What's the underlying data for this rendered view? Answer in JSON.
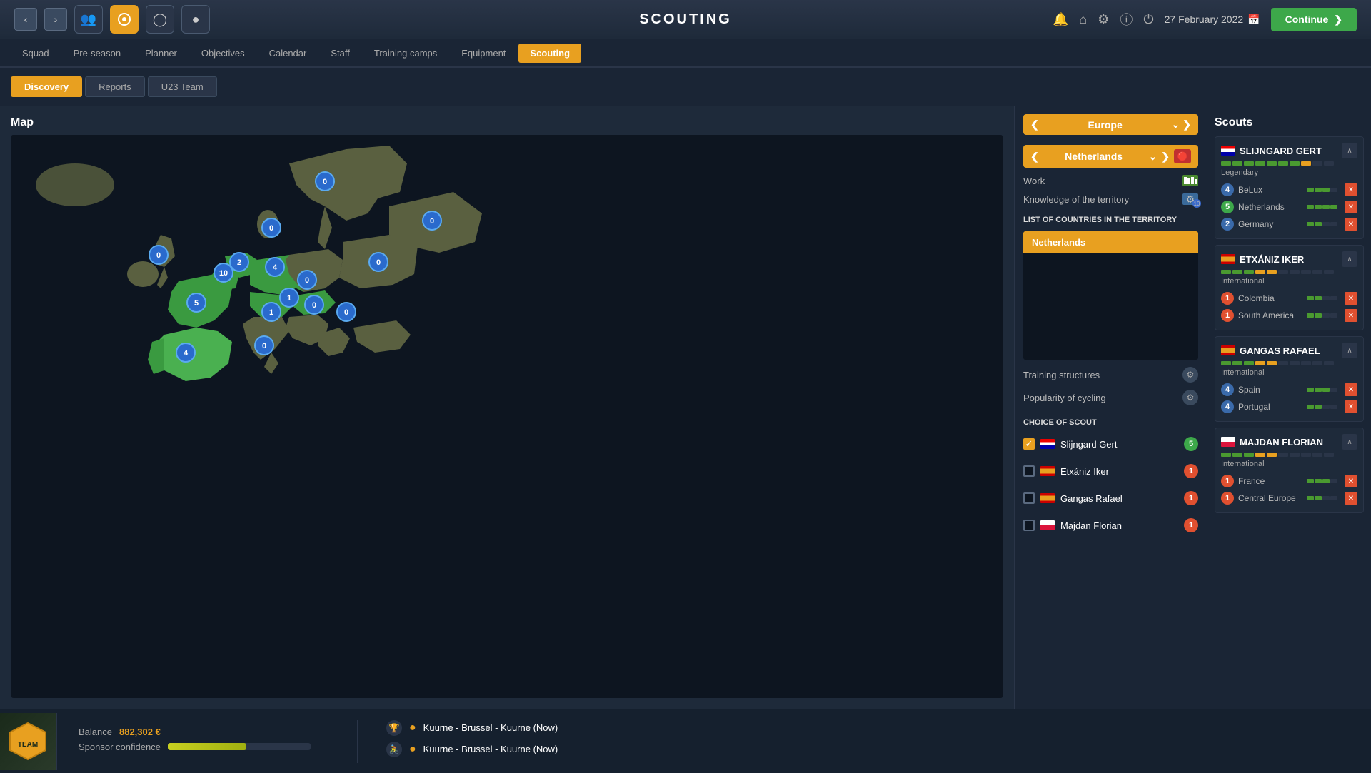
{
  "topbar": {
    "title": "SCOUTING",
    "date": "27 February 2022",
    "continue_label": "Continue"
  },
  "nav_tabs": [
    {
      "label": "Squad",
      "active": false
    },
    {
      "label": "Pre-season",
      "active": false
    },
    {
      "label": "Planner",
      "active": false
    },
    {
      "label": "Objectives",
      "active": false
    },
    {
      "label": "Calendar",
      "active": false
    },
    {
      "label": "Staff",
      "active": false
    },
    {
      "label": "Training camps",
      "active": false
    },
    {
      "label": "Equipment",
      "active": false
    },
    {
      "label": "Scouting",
      "active": true
    }
  ],
  "sub_tabs": [
    {
      "label": "Discovery",
      "active": true
    },
    {
      "label": "Reports",
      "active": false
    },
    {
      "label": "U23 Team",
      "active": false
    }
  ],
  "map_title": "Map",
  "region_selector": {
    "label": "Europe"
  },
  "sub_region_selector": {
    "label": "Netherlands"
  },
  "info_rows": {
    "work": "Work",
    "knowledge": "Knowledge of the territory"
  },
  "countries_list_title": "LIST OF COUNTRIES IN THE TERRITORY",
  "countries": [
    {
      "name": "Netherlands",
      "selected": true
    }
  ],
  "stats": {
    "training_structures": "Training structures",
    "popularity": "Popularity of cycling"
  },
  "choice_of_scout": "CHOICE OF SCOUT",
  "scouts_choice": [
    {
      "name": "Slijngard Gert",
      "flag": "nl",
      "checked": true,
      "num": 5,
      "num_color": "green"
    },
    {
      "name": "Etxániz Iker",
      "flag": "es",
      "checked": false,
      "num": 1,
      "num_color": "red"
    },
    {
      "name": "Gangas Rafael",
      "flag": "es",
      "checked": false,
      "num": 1,
      "num_color": "red"
    },
    {
      "name": "Majdan Florian",
      "flag": "pl",
      "checked": false,
      "num": 1,
      "num_color": "red"
    }
  ],
  "scouts_panel_title": "Scouts",
  "scouts": [
    {
      "id": "slijngard",
      "name": "SLIJNGARD GERT",
      "flag": "nl",
      "level": "Legendary",
      "skill_filled": 8,
      "skill_total": 10,
      "regions": [
        {
          "name": "BeLux",
          "num": 4,
          "num_color": "blue"
        },
        {
          "name": "Netherlands",
          "num": 5,
          "num_color": "green"
        },
        {
          "name": "Germany",
          "num": 2,
          "num_color": "blue"
        }
      ]
    },
    {
      "id": "etxaniz",
      "name": "ETXÁNIZ IKER",
      "flag": "es",
      "level": "International",
      "skill_filled": 6,
      "skill_total": 10,
      "regions": [
        {
          "name": "Colombia",
          "num": 1,
          "num_color": "red"
        },
        {
          "name": "South America",
          "num": 1,
          "num_color": "red"
        }
      ]
    },
    {
      "id": "gangas",
      "name": "GANGAS RAFAEL",
      "flag": "es",
      "level": "International",
      "skill_filled": 6,
      "skill_total": 10,
      "regions": [
        {
          "name": "Spain",
          "num": 4,
          "num_color": "blue"
        },
        {
          "name": "Portugal",
          "num": 4,
          "num_color": "blue"
        }
      ]
    },
    {
      "id": "majdan",
      "name": "MAJDAN FLORIAN",
      "flag": "pl",
      "level": "International",
      "skill_filled": 6,
      "skill_total": 10,
      "regions": [
        {
          "name": "France",
          "num": 1,
          "num_color": "red"
        },
        {
          "name": "Central Europe",
          "num": 1,
          "num_color": "red"
        }
      ]
    }
  ],
  "bottom": {
    "balance_label": "Balance",
    "balance_value": "882,302 €",
    "sponsor_label": "Sponsor confidence",
    "sponsor_pct": 55,
    "race1": "Kuurne - Brussel - Kuurne (Now)",
    "race2": "Kuurne - Brussel - Kuurne (Now)"
  }
}
